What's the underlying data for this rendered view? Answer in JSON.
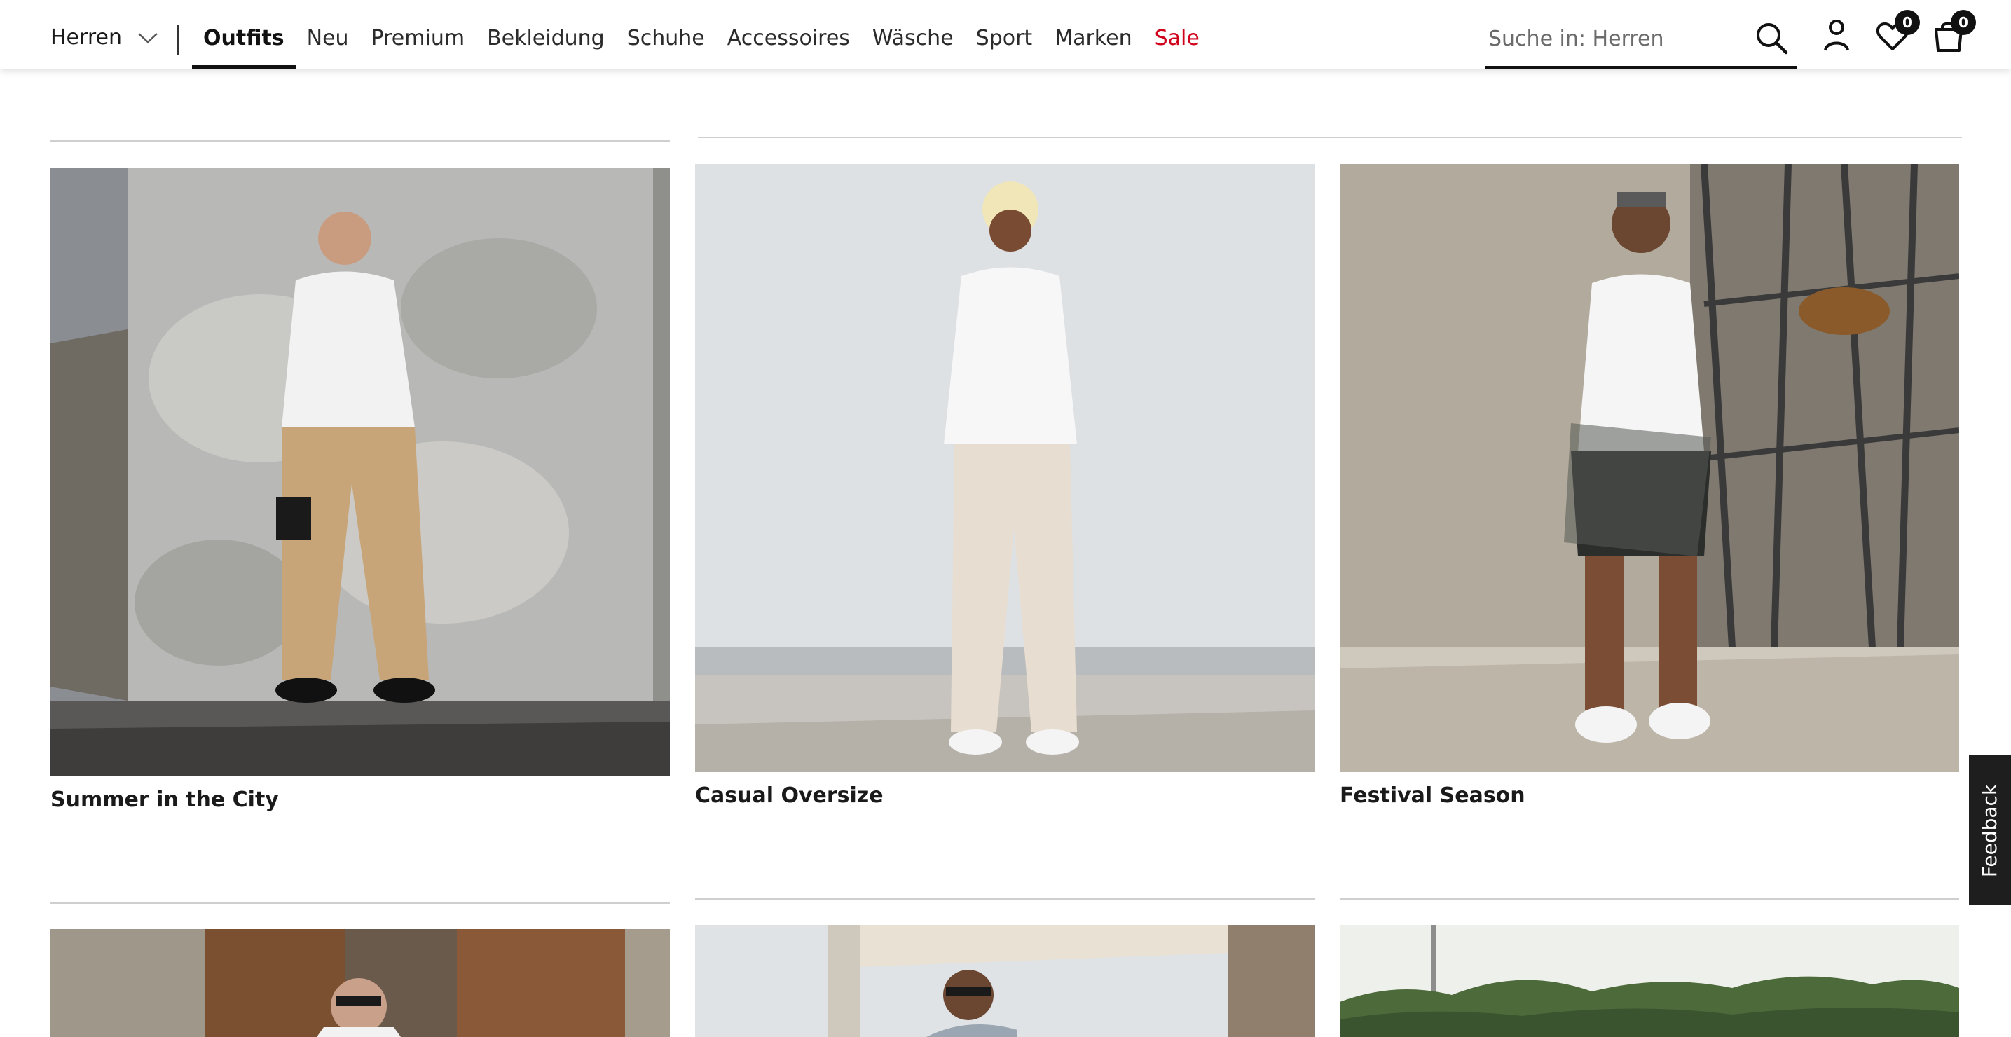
{
  "header": {
    "gender": "Herren",
    "nav": [
      {
        "label": "Outfits",
        "active": true
      },
      {
        "label": "Neu"
      },
      {
        "label": "Premium"
      },
      {
        "label": "Bekleidung"
      },
      {
        "label": "Schuhe"
      },
      {
        "label": "Accessoires"
      },
      {
        "label": "Wäsche"
      },
      {
        "label": "Sport"
      },
      {
        "label": "Marken"
      },
      {
        "label": "Sale",
        "sale": true
      }
    ],
    "search_placeholder": "Suche in: Herren",
    "wishlist_count": "0",
    "cart_count": "0",
    "icons": {
      "gender_toggle": "chevron-down-icon",
      "search": "search-icon",
      "account": "user-icon",
      "wishlist": "heart-icon",
      "cart": "bag-icon"
    }
  },
  "outfits": [
    {
      "title": "Summer in the City"
    },
    {
      "title": "Casual Oversize"
    },
    {
      "title": "Festival Season"
    },
    {
      "title": ""
    },
    {
      "title": ""
    },
    {
      "title": ""
    }
  ],
  "feedback_label": "Feedback",
  "colors": {
    "text": "#1a1a1a",
    "sale": "#d0021b",
    "badge": "#111111",
    "feedback_bg": "#1e1e1e"
  }
}
